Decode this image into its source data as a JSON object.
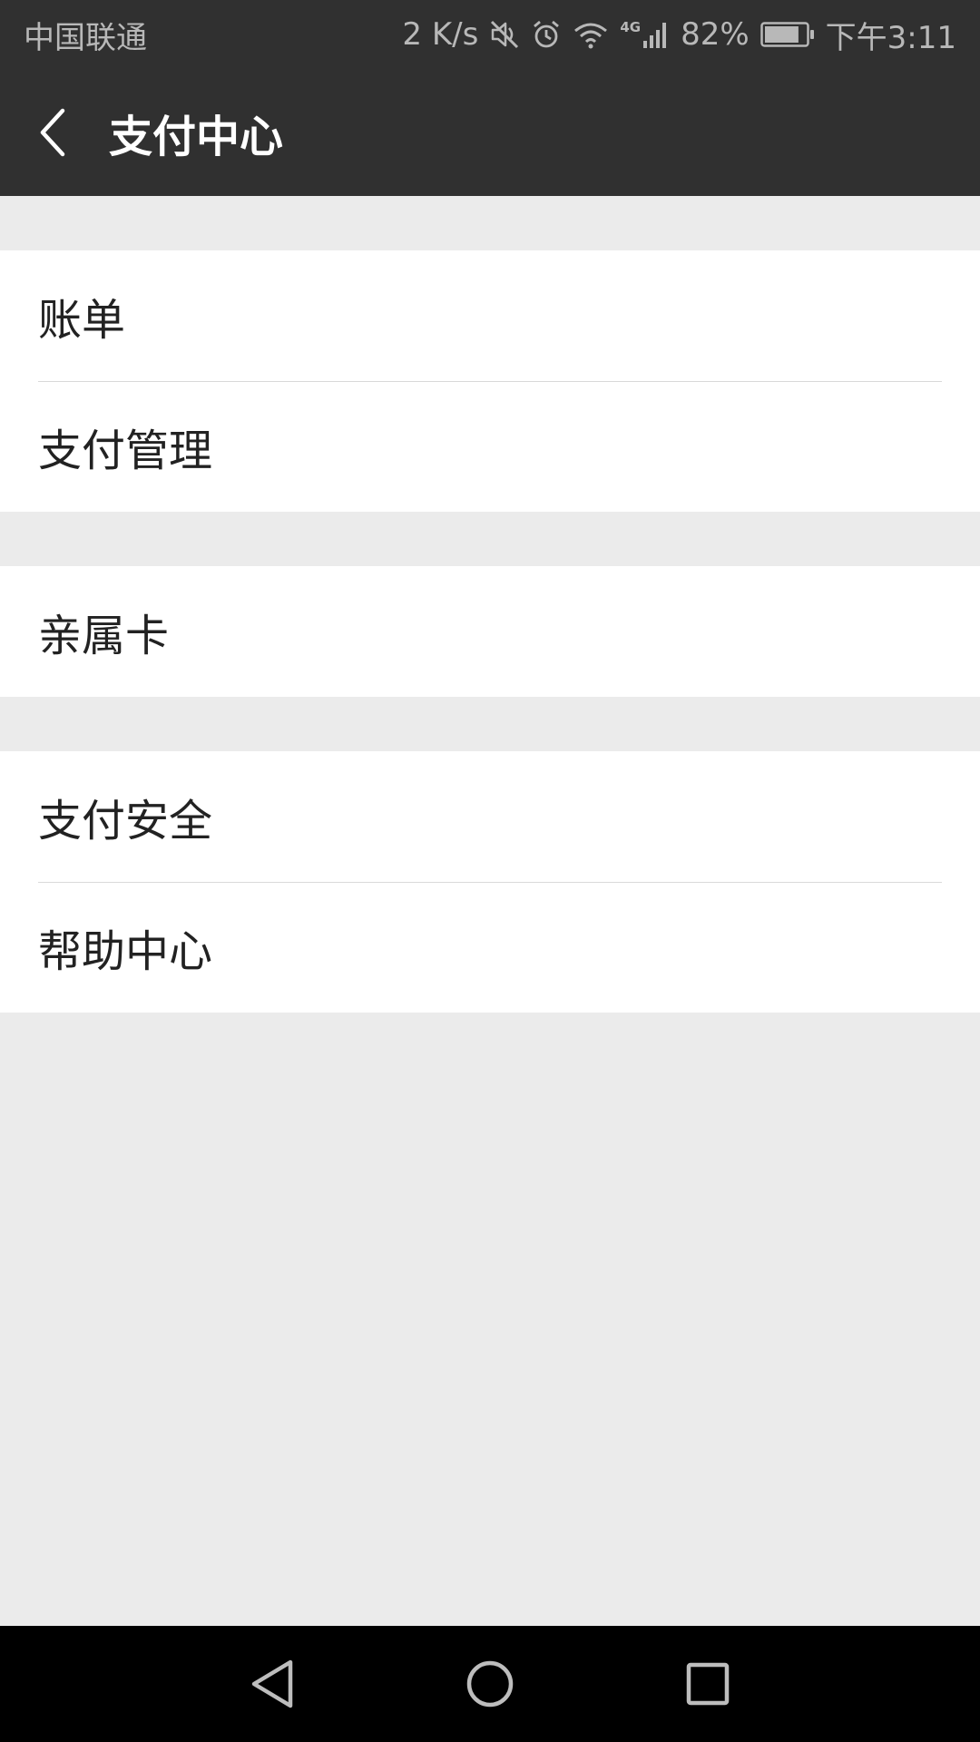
{
  "status_bar": {
    "carrier": "中国联通",
    "net_speed": "2 K/s",
    "network_type": "4G",
    "battery_percent": "82%",
    "time": "下午3:11",
    "battery_level": 0.82,
    "icons": [
      "mute-icon",
      "alarm-icon",
      "wifi-icon",
      "signal-icon",
      "battery-icon"
    ]
  },
  "app_bar": {
    "title": "支付中心",
    "back_icon": "chevron-left-icon"
  },
  "groups": [
    {
      "items": [
        {
          "label": "账单"
        },
        {
          "label": "支付管理"
        }
      ]
    },
    {
      "items": [
        {
          "label": "亲属卡"
        }
      ]
    },
    {
      "items": [
        {
          "label": "支付安全"
        },
        {
          "label": "帮助中心"
        }
      ]
    }
  ],
  "nav_bar": {
    "icons": [
      "back-triangle-icon",
      "home-circle-icon",
      "recents-square-icon"
    ]
  },
  "colors": {
    "header_bg": "#303030",
    "page_bg": "#ebebeb",
    "row_bg": "#ffffff",
    "divider": "#d9d9d9",
    "nav_bg": "#000000"
  }
}
